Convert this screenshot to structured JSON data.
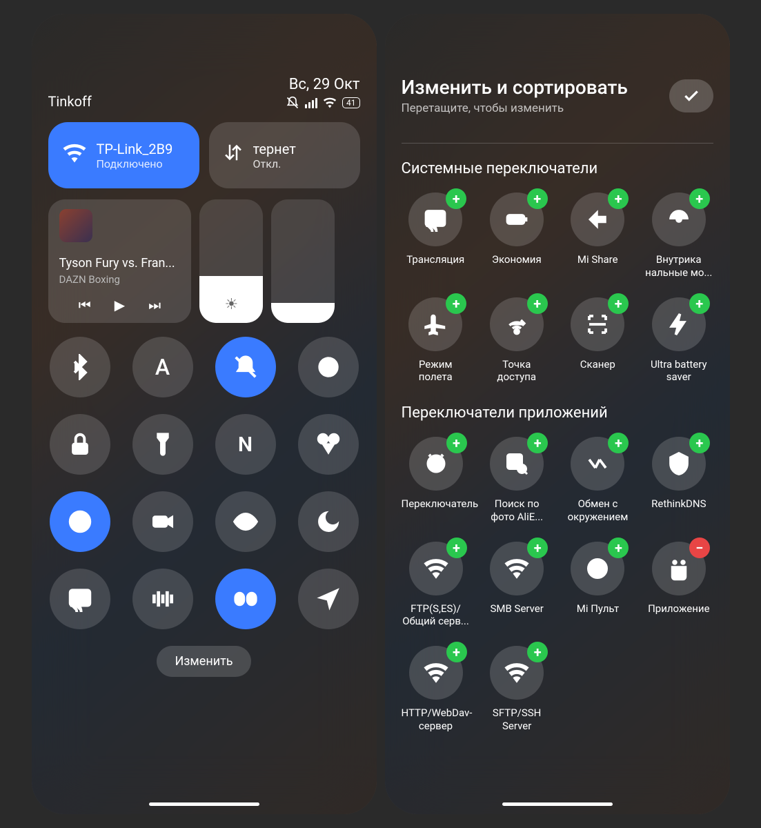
{
  "left": {
    "carrier": "Tinkoff",
    "date": "Вс, 29 Окт",
    "battery": "41",
    "wifi": {
      "ssid": "TP-Link_2B9",
      "status": "Подключено"
    },
    "data": {
      "title": "тернет",
      "status": "Откл."
    },
    "media": {
      "title": "Tyson Fury vs. Fran...",
      "source": "DAZN Boxing"
    },
    "toggles": [
      {
        "name": "bluetooth",
        "active": false
      },
      {
        "name": "auto-brightness",
        "active": false
      },
      {
        "name": "mute",
        "active": true
      },
      {
        "name": "dark-mode",
        "active": false
      },
      {
        "name": "lock",
        "active": false
      },
      {
        "name": "flashlight",
        "active": false
      },
      {
        "name": "nfc",
        "active": false
      },
      {
        "name": "screenshot",
        "active": false
      },
      {
        "name": "rotation-lock",
        "active": true
      },
      {
        "name": "screen-record",
        "active": false
      },
      {
        "name": "eye-comfort",
        "active": false
      },
      {
        "name": "dnd-moon",
        "active": false
      },
      {
        "name": "cast",
        "active": false
      },
      {
        "name": "vibrate",
        "active": false
      },
      {
        "name": "dolby",
        "active": true
      },
      {
        "name": "location",
        "active": false
      }
    ],
    "edit_button": "Изменить"
  },
  "right": {
    "title": "Изменить и сортировать",
    "subtitle": "Перетащите, чтобы изменить",
    "section1": "Системные переключатели",
    "section2": "Переключатели приложений",
    "sys": [
      {
        "name": "cast",
        "label": "Трансляция"
      },
      {
        "name": "battery-saver",
        "label": "Экономия"
      },
      {
        "name": "mi-share",
        "label": "Mi Share"
      },
      {
        "name": "in-ear",
        "label": "Внутрика нальные мо..."
      },
      {
        "name": "airplane",
        "label": "Режим полета"
      },
      {
        "name": "hotspot",
        "label": "Точка доступа"
      },
      {
        "name": "scanner",
        "label": "Сканер"
      },
      {
        "name": "ultra-battery",
        "label": "Ultra battery saver"
      }
    ],
    "app": [
      {
        "name": "switcher",
        "label": "Переключатель"
      },
      {
        "name": "ali-photo",
        "label": "Поиск по фото AliE..."
      },
      {
        "name": "nearby-share",
        "label": "Обмен с окружением"
      },
      {
        "name": "rethink-dns",
        "label": "RethinkDNS"
      },
      {
        "name": "ftp",
        "label": "FTP(S,ES)/ Общий серв..."
      },
      {
        "name": "smb",
        "label": "SMB Server"
      },
      {
        "name": "mi-remote",
        "label": "Mi Пульт"
      },
      {
        "name": "app",
        "label": "Приложение",
        "badge": "red"
      },
      {
        "name": "http-webdav",
        "label": "HTTP/WebDav-сервер"
      },
      {
        "name": "sftp-ssh",
        "label": "SFTP/SSH Server"
      }
    ]
  }
}
